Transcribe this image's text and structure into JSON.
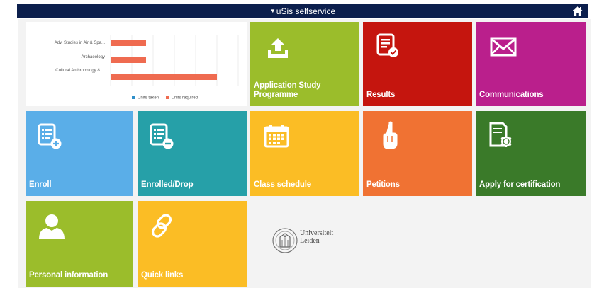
{
  "header": {
    "title": "uSis selfservice",
    "home_icon": "home-icon",
    "bar_color": "#0c1f4d"
  },
  "chart_data": {
    "type": "bar",
    "orientation": "horizontal",
    "categories": [
      "Adv. Studies in Air & Spa...",
      "Archaeology",
      "Cultural Anthropology & ..."
    ],
    "series": [
      {
        "name": "Units taken",
        "color": "#2f8fc9",
        "values": [
          0,
          0,
          0
        ]
      },
      {
        "name": "Units required",
        "color": "#ef6b50",
        "values": [
          5,
          5,
          15
        ]
      }
    ],
    "xlim": [
      0,
      18
    ],
    "legend_position": "bottom",
    "grid": true
  },
  "tiles": [
    {
      "id": "application-study-programme",
      "label": "Application Study Programme",
      "color": "#9bbd2b",
      "icon": "upload-icon"
    },
    {
      "id": "results",
      "label": "Results",
      "color": "#c5150e",
      "icon": "results-document-icon"
    },
    {
      "id": "communications",
      "label": "Communications",
      "color": "#ba1f8c",
      "icon": "envelope-icon"
    },
    {
      "id": "enroll",
      "label": "Enroll",
      "color": "#5aaee8",
      "icon": "enroll-list-plus-icon"
    },
    {
      "id": "enrolled-drop",
      "label": "Enrolled/Drop",
      "color": "#26a0a8",
      "icon": "enrolled-list-minus-icon"
    },
    {
      "id": "class-schedule",
      "label": "Class schedule",
      "color": "#fbbd25",
      "icon": "calendar-icon"
    },
    {
      "id": "petitions",
      "label": "Petitions",
      "color": "#f07233",
      "icon": "raised-hand-icon"
    },
    {
      "id": "apply-for-certification",
      "label": "Apply for certification",
      "color": "#3a7a29",
      "icon": "certificate-icon"
    },
    {
      "id": "personal-information",
      "label": "Personal information",
      "color": "#9bbd2b",
      "icon": "person-icon"
    },
    {
      "id": "quick-links",
      "label": "Quick links",
      "color": "#fbbd25",
      "icon": "link-icon"
    }
  ],
  "logo": {
    "line1": "Universiteit",
    "line2": "Leiden",
    "icon": "university-seal-icon"
  }
}
